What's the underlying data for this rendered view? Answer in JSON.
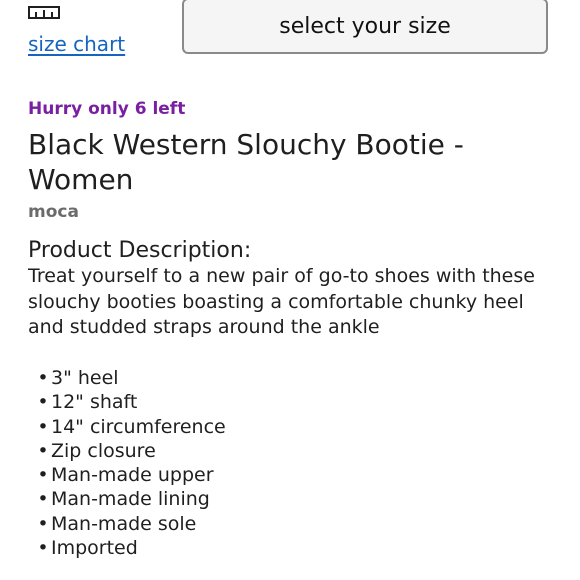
{
  "size_chart": {
    "icon": "ruler-icon",
    "link_label": "size chart"
  },
  "size_selector": {
    "label": "select your size"
  },
  "stock_badge": "Hurry only 6 left",
  "product": {
    "title": "Black Western Slouchy Bootie - Women",
    "brand": "moca"
  },
  "description": {
    "heading": "Product Description:",
    "text": "Treat yourself to a new pair of go-to shoes with these slouchy booties boasting a comfortable chunky heel and studded straps around the ankle",
    "features": [
      "3\" heel",
      "12\" shaft",
      "14\" circumference",
      "Zip closure",
      "Man-made upper",
      "Man-made lining",
      "Man-made sole",
      "Imported"
    ]
  },
  "colors": {
    "link": "#1565c0",
    "stock_badge": "#7b1fa2",
    "brand": "#6b6b6b",
    "text": "#1f1f1f",
    "select_border": "#8a8a8a"
  }
}
